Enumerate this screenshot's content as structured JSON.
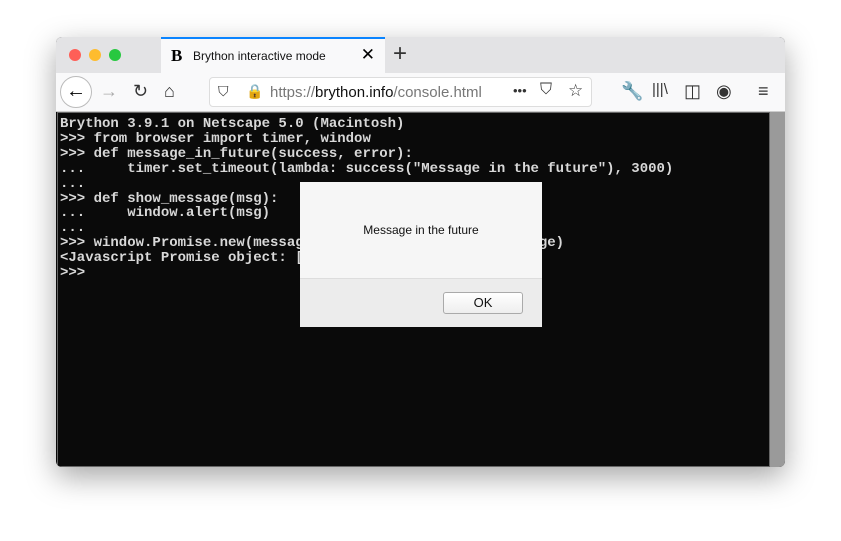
{
  "tab": {
    "favicon": "B",
    "title": "Brython interactive mode"
  },
  "toolbar": {
    "url_scheme": "https://",
    "url_domain": "brython.info",
    "url_path": "/console.html",
    "more": "•••"
  },
  "console": {
    "lines": [
      "Brython 3.9.1 on Netscape 5.0 (Macintosh)",
      ">>> from browser import timer, window",
      ">>> def message_in_future(success, error):",
      "...     timer.set_timeout(lambda: success(\"Message in the future\"), 3000)",
      "...",
      ">>> def show_message(msg):",
      "...     window.alert(msg)",
      "...",
      ">>> window.Promise.new(messag                            ge)",
      "<Javascript Promise object: [",
      ">>>"
    ]
  },
  "dialog": {
    "message": "Message in the future",
    "ok_label": "OK"
  }
}
